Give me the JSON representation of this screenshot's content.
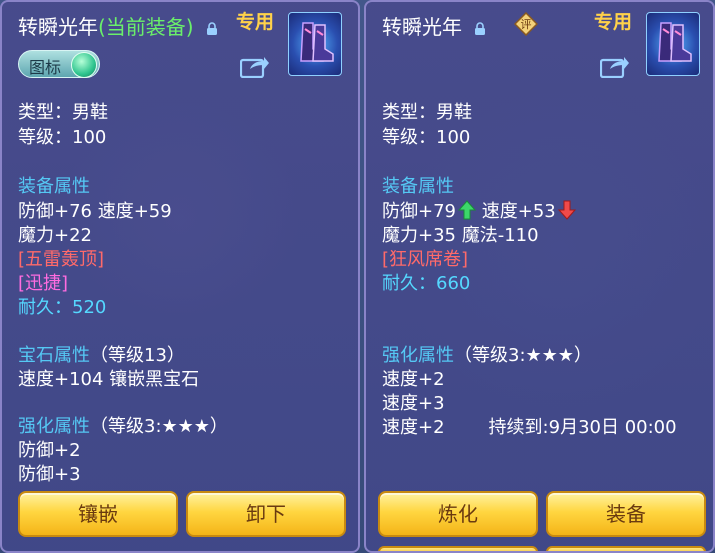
{
  "left": {
    "title": "转瞬光年",
    "title_suffix": "(当前装备)",
    "special": "专用",
    "toggle_label": "图标",
    "type": "类型：男鞋",
    "level": "等级：100",
    "equip_header": "装备属性",
    "stat1": "防御+76 速度+59",
    "stat2": "魔力+22",
    "skill1": "[五雷轰顶]",
    "skill2": "[迅捷]",
    "durability": "耐久：520",
    "gem_header": "宝石属性",
    "gem_level": "（等级13）",
    "gem_stat": "速度+104 镶嵌黑宝石",
    "enh_header": "强化属性",
    "enh_level": "（等级3:★★★）",
    "enh1": "防御+2",
    "enh2": "防御+3",
    "btn_inlay": "镶嵌",
    "btn_unequip": "卸下"
  },
  "right": {
    "title": "转瞬光年",
    "eval_badge": "评",
    "special": "专用",
    "type": "类型：男鞋",
    "level": "等级：100",
    "equip_header": "装备属性",
    "stat_def": "防御+79",
    "stat_spd": "速度+53",
    "stat2": "魔力+35 魔法-110",
    "skill1": "[狂风席卷]",
    "durability": "耐久：660",
    "enh_header": "强化属性",
    "enh_level": "（等级3:★★★）",
    "enh1": "速度+2",
    "enh2": "速度+3",
    "enh3": "速度+2",
    "enh3_duration": "持续到:9月30日 00:00",
    "btn_refine": "炼化",
    "btn_equip": "装备"
  },
  "colors": {
    "title_green": "#6af06a",
    "header_blue": "#55c8f4",
    "skill_red": "#ff6a6a",
    "skill_pink": "#ff6ce0",
    "durability_cyan": "#55d8ff",
    "special_gold": "#ffd24a",
    "button_gold": "#ffd640"
  },
  "icons": [
    "lock-icon",
    "boots-item-icon",
    "share-icon",
    "toggle-knob",
    "up-arrow-icon",
    "down-arrow-icon",
    "evaluate-badge-icon"
  ]
}
